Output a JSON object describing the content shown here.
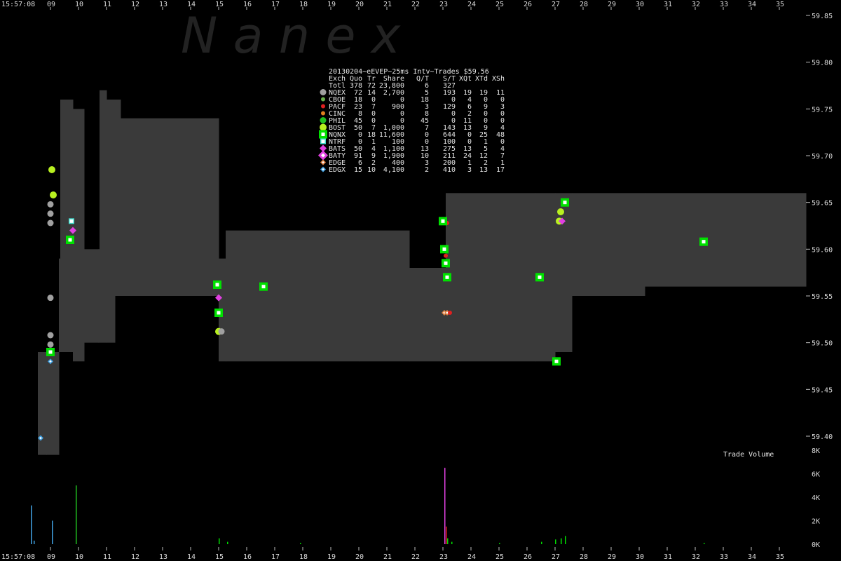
{
  "watermark": "N a n e x",
  "time_left_top": "15:57:08",
  "time_left_bottom": "15:57:08",
  "colors": {
    "background": "#000000",
    "nbbo_band": "#3a3a3a",
    "tick_text": "#dcdcdc"
  },
  "chart_data": {
    "type": "scatter",
    "title": "20130204~eEVEP~25ms Intv~Trades $59.56",
    "xlabel": "",
    "ylabel": "",
    "x_ticks": [
      "09",
      "10",
      "11",
      "12",
      "13",
      "14",
      "15",
      "16",
      "17",
      "18",
      "19",
      "20",
      "21",
      "22",
      "23",
      "24",
      "25",
      "26",
      "27",
      "28",
      "29",
      "30",
      "31",
      "32",
      "33",
      "34",
      "35"
    ],
    "xlim": [
      8.15,
      35.95
    ],
    "y_ticks": [
      "59.85",
      "59.80",
      "59.75",
      "59.70",
      "59.65",
      "59.60",
      "59.55",
      "59.50",
      "59.45",
      "59.40"
    ],
    "ylim": [
      59.375,
      59.875
    ],
    "volume_label": "Trade Volume",
    "volume_ticks": [
      "8K",
      "6K",
      "4K",
      "2K",
      "0K"
    ],
    "volume_ylim": [
      0,
      8000
    ],
    "table": {
      "header": [
        "Exch",
        "Quo",
        "Tr",
        "Share",
        "Q/T",
        "S/T",
        "XQt",
        "XTd",
        "XSh"
      ],
      "total": [
        "Totl",
        "378",
        "72",
        "23,800",
        "6",
        "327",
        "",
        "",
        ""
      ],
      "rows": [
        {
          "exch": "NQEX",
          "quo": "72",
          "tr": "14",
          "share": "2,700",
          "qt": "5",
          "st": "193",
          "xqt": "19",
          "xtd": "19",
          "xsh": "11",
          "color": "#a0a0a0",
          "marker": "circle"
        },
        {
          "exch": "CBOE",
          "quo": "18",
          "tr": "0",
          "share": "0",
          "qt": "18",
          "st": "0",
          "xqt": "4",
          "xtd": "0",
          "xsh": "0",
          "color": "#6ab04c",
          "marker": "circle-small"
        },
        {
          "exch": "PACF",
          "quo": "23",
          "tr": "7",
          "share": "900",
          "qt": "3",
          "st": "129",
          "xqt": "6",
          "xtd": "9",
          "xsh": "3",
          "color": "#e02020",
          "marker": "circle-small"
        },
        {
          "exch": "CINC",
          "quo": "8",
          "tr": "0",
          "share": "0",
          "qt": "8",
          "st": "0",
          "xqt": "2",
          "xtd": "0",
          "xsh": "0",
          "color": "#e08020",
          "marker": "circle-small"
        },
        {
          "exch": "PHIL",
          "quo": "45",
          "tr": "0",
          "share": "0",
          "qt": "45",
          "st": "0",
          "xqt": "11",
          "xtd": "0",
          "xsh": "0",
          "color": "#20c020",
          "marker": "circle"
        },
        {
          "exch": "BOST",
          "quo": "50",
          "tr": "7",
          "share": "1,000",
          "qt": "7",
          "st": "143",
          "xqt": "13",
          "xtd": "9",
          "xsh": "4",
          "color": "#b8f020",
          "marker": "circle-large"
        },
        {
          "exch": "NQNX",
          "quo": "0",
          "tr": "18",
          "share": "11,600",
          "qt": "0",
          "st": "644",
          "xqt": "0",
          "xtd": "25",
          "xsh": "48",
          "color": "#00e000",
          "marker": "square"
        },
        {
          "exch": "NTRF",
          "quo": "0",
          "tr": "1",
          "share": "100",
          "qt": "0",
          "st": "100",
          "xqt": "0",
          "xtd": "1",
          "xsh": "0",
          "color": "#40e0d0",
          "marker": "square-small"
        },
        {
          "exch": "BATS",
          "quo": "50",
          "tr": "4",
          "share": "1,100",
          "qt": "13",
          "st": "275",
          "xqt": "13",
          "xtd": "5",
          "xsh": "4",
          "color": "#e040e0",
          "marker": "diamond"
        },
        {
          "exch": "BATY",
          "quo": "91",
          "tr": "9",
          "share": "1,900",
          "qt": "10",
          "st": "211",
          "xqt": "24",
          "xtd": "12",
          "xsh": "7",
          "color": "#e040e0",
          "marker": "diamond-large"
        },
        {
          "exch": "EDGE",
          "quo": "6",
          "tr": "2",
          "share": "400",
          "qt": "3",
          "st": "200",
          "xqt": "1",
          "xtd": "2",
          "xsh": "1",
          "color": "#e08040",
          "marker": "diamond-small"
        },
        {
          "exch": "EDGX",
          "quo": "15",
          "tr": "10",
          "share": "4,100",
          "qt": "2",
          "st": "410",
          "xqt": "3",
          "xtd": "13",
          "xsh": "17",
          "color": "#40a0e0",
          "marker": "diamond-small"
        }
      ]
    },
    "nbbo_band": [
      [
        8.55,
        59.38,
        59.49
      ],
      [
        8.85,
        59.38,
        59.49
      ],
      [
        9.3,
        59.49,
        59.59
      ],
      [
        9.35,
        59.49,
        59.76
      ],
      [
        9.8,
        59.48,
        59.75
      ],
      [
        10.2,
        59.5,
        59.6
      ],
      [
        10.7,
        59.5,
        59.6
      ],
      [
        10.75,
        59.5,
        59.77
      ],
      [
        11.0,
        59.5,
        59.76
      ],
      [
        11.3,
        59.55,
        59.76
      ],
      [
        11.5,
        59.55,
        59.74
      ],
      [
        14.95,
        59.55,
        59.74
      ],
      [
        15.0,
        59.48,
        59.59
      ],
      [
        15.25,
        59.48,
        59.62
      ],
      [
        20.0,
        59.48,
        59.62
      ],
      [
        21.8,
        59.48,
        59.58
      ],
      [
        23.1,
        59.48,
        59.66
      ],
      [
        23.6,
        59.48,
        59.66
      ],
      [
        26.3,
        59.48,
        59.66
      ],
      [
        27.0,
        59.49,
        59.66
      ],
      [
        27.6,
        59.55,
        59.66
      ],
      [
        30.2,
        59.56,
        59.66
      ],
      [
        35.95,
        59.56,
        59.66
      ]
    ],
    "quotes": [
      {
        "exch": "EDGX",
        "x": 8.65,
        "y": 59.398
      },
      {
        "exch": "BOST",
        "x": 9.05,
        "y": 59.685
      },
      {
        "exch": "BOST",
        "x": 9.1,
        "y": 59.658
      },
      {
        "exch": "NQEX",
        "x": 9.0,
        "y": 59.648
      },
      {
        "exch": "NQEX",
        "x": 9.0,
        "y": 59.638
      },
      {
        "exch": "NQEX",
        "x": 9.0,
        "y": 59.628
      },
      {
        "exch": "NQEX",
        "x": 9.0,
        "y": 59.548
      },
      {
        "exch": "NQEX",
        "x": 9.0,
        "y": 59.508
      },
      {
        "exch": "NQEX",
        "x": 9.0,
        "y": 59.498
      },
      {
        "exch": "NQNX",
        "x": 9.0,
        "y": 59.49
      },
      {
        "exch": "EDGX",
        "x": 9.0,
        "y": 59.48
      },
      {
        "exch": "NTRF",
        "x": 9.75,
        "y": 59.63
      },
      {
        "exch": "BATS",
        "x": 9.8,
        "y": 59.62
      },
      {
        "exch": "NQNX",
        "x": 9.7,
        "y": 59.61
      },
      {
        "exch": "NQNX",
        "x": 14.95,
        "y": 59.562
      },
      {
        "exch": "BATS",
        "x": 15.0,
        "y": 59.548
      },
      {
        "exch": "NQNX",
        "x": 15.0,
        "y": 59.532
      },
      {
        "exch": "BOST",
        "x": 15.0,
        "y": 59.512
      },
      {
        "exch": "NQEX",
        "x": 15.1,
        "y": 59.512
      },
      {
        "exch": "NQNX",
        "x": 16.6,
        "y": 59.56
      },
      {
        "exch": "PACF",
        "x": 23.1,
        "y": 59.628
      },
      {
        "exch": "PACF",
        "x": 23.15,
        "y": 59.628
      },
      {
        "exch": "NQNX",
        "x": 23.0,
        "y": 59.63
      },
      {
        "exch": "NQNX",
        "x": 23.05,
        "y": 59.6
      },
      {
        "exch": "PACF",
        "x": 23.1,
        "y": 59.593
      },
      {
        "exch": "NQNX",
        "x": 23.1,
        "y": 59.585
      },
      {
        "exch": "NQNX",
        "x": 23.15,
        "y": 59.57
      },
      {
        "exch": "EDGE",
        "x": 23.05,
        "y": 59.532
      },
      {
        "exch": "EDGE",
        "x": 23.15,
        "y": 59.532
      },
      {
        "exch": "PACF",
        "x": 23.25,
        "y": 59.532
      },
      {
        "exch": "NQNX",
        "x": 26.45,
        "y": 59.57
      },
      {
        "exch": "NQNX",
        "x": 27.05,
        "y": 59.48
      },
      {
        "exch": "NQNX",
        "x": 27.35,
        "y": 59.65
      },
      {
        "exch": "BOST",
        "x": 27.2,
        "y": 59.64
      },
      {
        "exch": "BOST",
        "x": 27.15,
        "y": 59.63
      },
      {
        "exch": "BATS",
        "x": 27.25,
        "y": 59.63
      },
      {
        "exch": "NQNX",
        "x": 32.3,
        "y": 59.608
      }
    ],
    "volume_bars": [
      {
        "x": 8.3,
        "v": 3300,
        "color": "#40a0e0"
      },
      {
        "x": 8.4,
        "v": 300,
        "color": "#40a0e0"
      },
      {
        "x": 9.05,
        "v": 2000,
        "color": "#40a0e0"
      },
      {
        "x": 9.9,
        "v": 5000,
        "color": "#20c020"
      },
      {
        "x": 15.0,
        "v": 500,
        "color": "#00e000"
      },
      {
        "x": 15.3,
        "v": 200,
        "color": "#00e000"
      },
      {
        "x": 17.9,
        "v": 100,
        "color": "#00e000"
      },
      {
        "x": 23.05,
        "v": 6500,
        "color": "#e040e0"
      },
      {
        "x": 23.1,
        "v": 1500,
        "color": "#e02020"
      },
      {
        "x": 23.15,
        "v": 500,
        "color": "#00e000"
      },
      {
        "x": 23.3,
        "v": 200,
        "color": "#00e000"
      },
      {
        "x": 25.0,
        "v": 100,
        "color": "#00e000"
      },
      {
        "x": 26.5,
        "v": 200,
        "color": "#00e000"
      },
      {
        "x": 27.0,
        "v": 400,
        "color": "#00e000"
      },
      {
        "x": 27.2,
        "v": 500,
        "color": "#00e000"
      },
      {
        "x": 27.35,
        "v": 700,
        "color": "#00e000"
      },
      {
        "x": 32.3,
        "v": 100,
        "color": "#00e000"
      }
    ]
  }
}
